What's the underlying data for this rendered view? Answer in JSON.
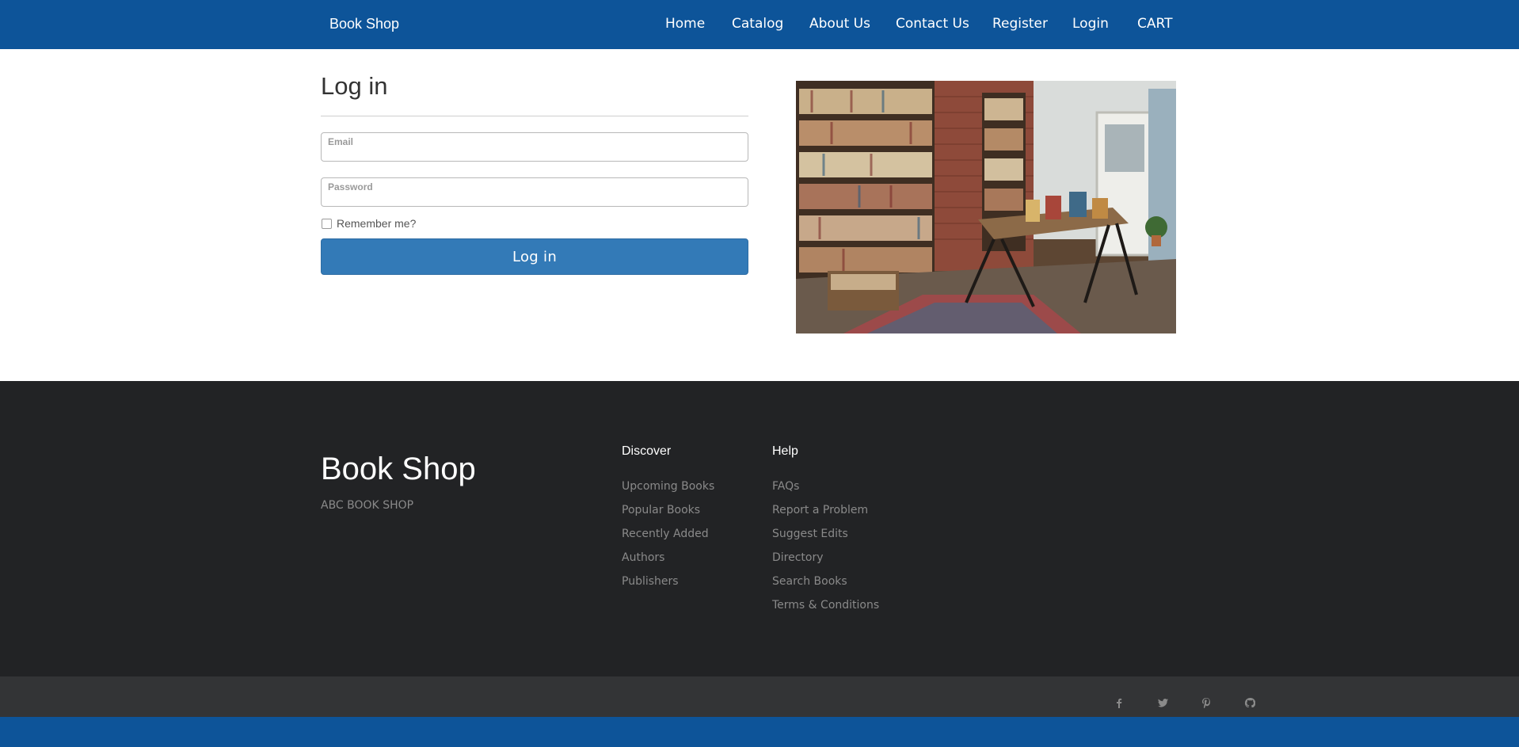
{
  "header": {
    "brand": "Book Shop",
    "nav": [
      "Home",
      "Catalog",
      "About Us",
      "Contact Us",
      "Register",
      "Login",
      "CART"
    ]
  },
  "login": {
    "title": "Log in",
    "email_placeholder": "Email",
    "password_placeholder": "Password",
    "remember_label": "Remember me?",
    "button_label": "Log in"
  },
  "footer": {
    "brand": "Book Shop",
    "tagline": "ABC BOOK SHOP",
    "discover": {
      "heading": "Discover",
      "links": [
        "Upcoming Books",
        "Popular Books",
        "Recently Added",
        "Authors",
        "Publishers"
      ]
    },
    "help": {
      "heading": "Help",
      "links": [
        "FAQs",
        "Report a Problem",
        "Suggest Edits",
        "Directory",
        "Search Books",
        "Terms & Conditions"
      ]
    }
  },
  "social_icons": [
    "facebook-icon",
    "twitter-icon",
    "pinterest-icon",
    "github-icon"
  ],
  "colors": {
    "primary": "#0d5499",
    "button": "#337ab7",
    "footer_bg": "#222325",
    "subfooter_bg": "#333436"
  }
}
